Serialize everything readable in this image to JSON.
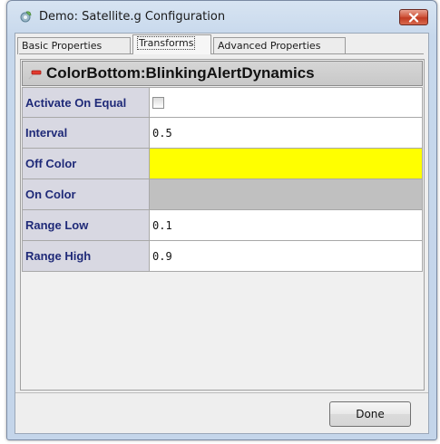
{
  "window": {
    "title": "Demo: Satellite.g Configuration",
    "app_icon": "gear-leaf-icon",
    "close_icon": "close-icon"
  },
  "tabs": [
    {
      "label": "Basic Properties",
      "active": false
    },
    {
      "label": "Transforms",
      "active": true
    },
    {
      "label": "Advanced Properties",
      "active": false
    }
  ],
  "section": {
    "title": "ColorBottom:BlinkingAlertDynamics",
    "collapse_icon": "collapse-minus-icon"
  },
  "properties": [
    {
      "label": "Activate On Equal",
      "type": "checkbox",
      "checked": false
    },
    {
      "label": "Interval",
      "type": "text",
      "value": "0.5"
    },
    {
      "label": "Off Color",
      "type": "color",
      "color": "#ffff00"
    },
    {
      "label": "On Color",
      "type": "color",
      "color": "#c0c0c0"
    },
    {
      "label": "Range Low",
      "type": "text",
      "value": "0.1"
    },
    {
      "label": "Range High",
      "type": "text",
      "value": "0.9"
    }
  ],
  "buttons": {
    "done": "Done"
  },
  "colors": {
    "label_text": "#1f2a78",
    "label_bg": "#d8d8e2",
    "close_button": "#c13b22"
  }
}
